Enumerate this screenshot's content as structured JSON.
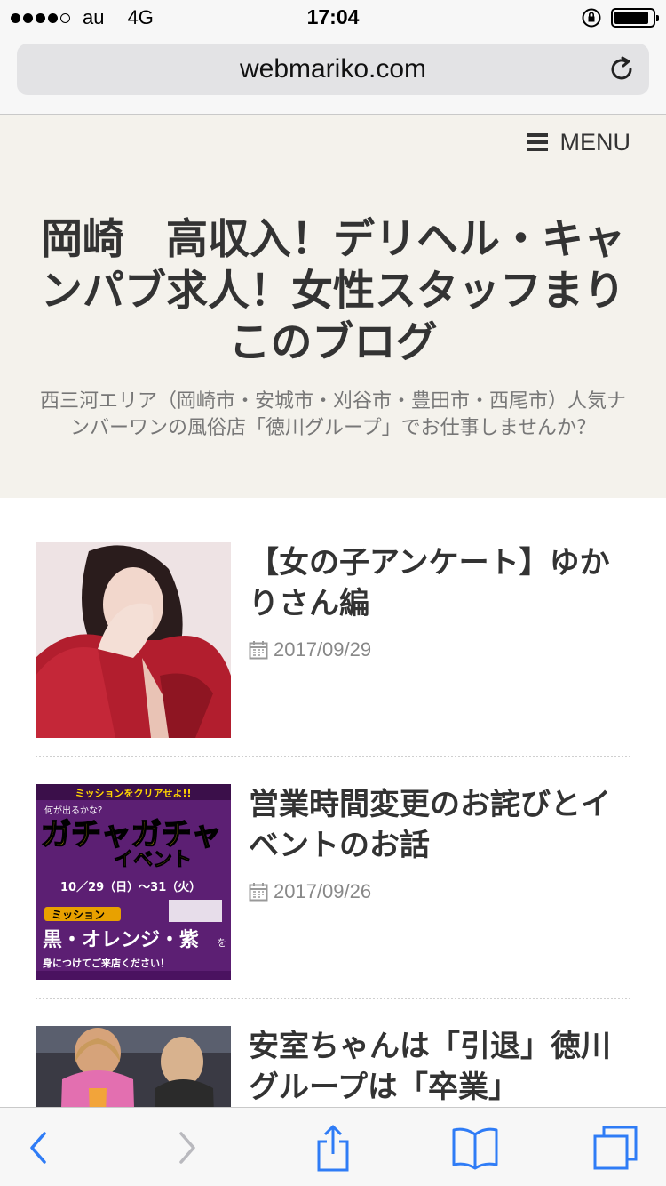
{
  "status_bar": {
    "carrier": "au",
    "network": "4G",
    "time": "17:04",
    "signal_bars_filled": 4,
    "signal_bars_total": 5,
    "battery_level": 0.9
  },
  "browser": {
    "url": "webmariko.com",
    "reload_icon": "reload-icon"
  },
  "header": {
    "menu_label": "MENU",
    "title": "岡崎　高収入！デリヘル・キャンパブ求人！女性スタッフまりこのブログ",
    "description": "西三河エリア（岡崎市・安城市・刈谷市・豊田市・西尾市）人気ナンバーワンの風俗店「徳川グループ」でお仕事しませんか？"
  },
  "posts": [
    {
      "title": "【女の子アンケート】ゆかりさん編",
      "date": "2017/09/29"
    },
    {
      "title": "営業時間変更のお詫びとイベントのお話",
      "date": "2017/09/26",
      "thumb_text": {
        "line1": "ミッションをクリアせよ!!",
        "line2": "何が出るかな？",
        "line3": "ガチャガチャ",
        "line4": "イベント",
        "line5": "10／29（日）～31（火）",
        "line6": "ミッション",
        "line7": "黒・オレンジ・紫",
        "line8": "を",
        "line9": "身につけてご来店ください！"
      }
    },
    {
      "title": "安室ちゃんは「引退」徳川グループは「卒業」",
      "date": ""
    }
  ],
  "colors": {
    "header_bg": "#f4f2ec",
    "ios_blue": "#2f7cf6",
    "text": "#333333"
  },
  "icons": {
    "back": "chevron-left-icon",
    "forward": "chevron-right-icon",
    "share": "share-icon",
    "bookmarks": "book-icon",
    "tabs": "tabs-icon",
    "calendar": "calendar-icon"
  }
}
